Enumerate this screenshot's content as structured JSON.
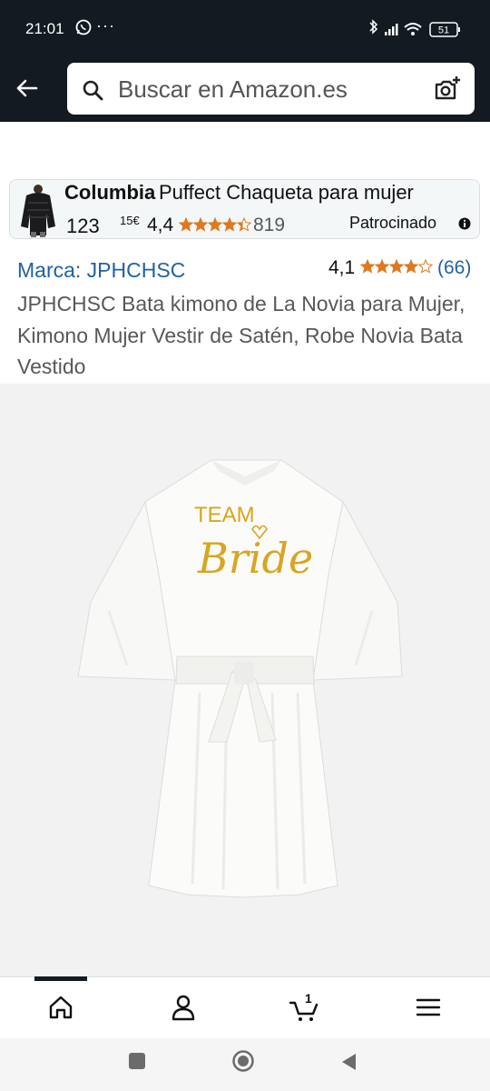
{
  "status_bar": {
    "time": "21:01",
    "more": "···",
    "battery": "51"
  },
  "search": {
    "placeholder": "Buscar en Amazon.es"
  },
  "sponsored": {
    "brand": "Columbia",
    "title": "Puffect Chaqueta para mujer",
    "price": "123",
    "cents": "15€",
    "rating": "4,4",
    "stars_value": 4.4,
    "review_count": "819",
    "label": "Patrocinado"
  },
  "product": {
    "brand_link": "Marca: JPHCHSC",
    "rating": "4,1",
    "stars_value": 4.1,
    "review_count": "(66)",
    "title": "JPHCHSC Bata kimono de La Novia para Mujer, Kimono Mujer Vestir de Satén, Robe Novia Bata Vestido",
    "image_text_1": "TEAM",
    "image_text_2": "Bride"
  },
  "nav": {
    "cart_count": "1"
  },
  "colors": {
    "header_bg": "#131a22",
    "link": "#2162a1",
    "star": "#de7921",
    "gold": "#d9a520"
  }
}
